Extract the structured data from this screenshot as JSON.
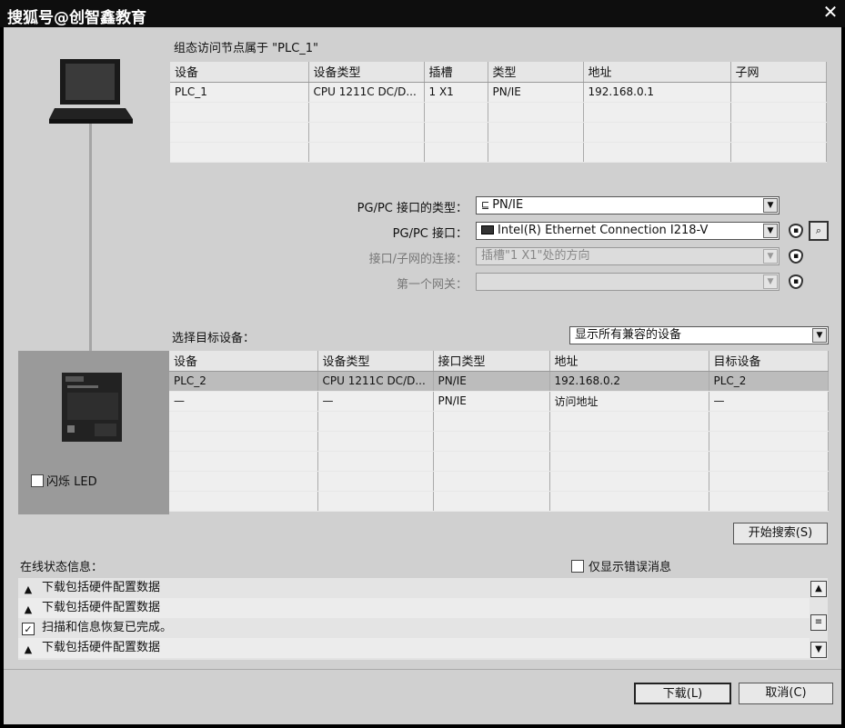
{
  "window": {
    "title": "搜狐号@创智鑫教育",
    "close_glyph": "✕"
  },
  "pg_section": {
    "heading": "组态访问节点属于 \"PLC_1\"",
    "columns": [
      "设备",
      "设备类型",
      "插槽",
      "类型",
      "地址",
      "子网"
    ],
    "rows": [
      [
        "PLC_1",
        "CPU 1211C DC/D...",
        "1 X1",
        "PN/IE",
        "192.168.0.1",
        ""
      ]
    ]
  },
  "settings": {
    "iface_type_label": "PG/PC 接口的类型：",
    "iface_type_value": "PN/IE",
    "iface_label": "PG/PC 接口：",
    "iface_value": "Intel(R) Ethernet Connection I218-V",
    "subnet_conn_label": "接口/子网的连接：",
    "subnet_conn_value": "插槽\"1 X1\"处的方向",
    "gateway_label": "第一个网关：",
    "gateway_value": ""
  },
  "target": {
    "label": "选择目标设备：",
    "filter_value": "显示所有兼容的设备",
    "columns": [
      "设备",
      "设备类型",
      "接口类型",
      "地址",
      "目标设备"
    ],
    "rows": [
      [
        "PLC_2",
        "CPU 1211C DC/D...",
        "PN/IE",
        "192.168.0.2",
        "PLC_2"
      ],
      [
        "—",
        "—",
        "PN/IE",
        "访问地址",
        "—"
      ]
    ],
    "flash_led_label": "闪烁 LED",
    "start_search_label": "开始搜索(S)"
  },
  "status": {
    "heading": "在线状态信息：",
    "errors_only_label": "仅显示错误消息",
    "messages": [
      {
        "icon": "warning",
        "text": "下载包括硬件配置数据"
      },
      {
        "icon": "warning",
        "text": "下载包括硬件配置数据"
      },
      {
        "icon": "success",
        "text": "扫描和信息恢复已完成。"
      },
      {
        "icon": "warning",
        "text": "下载包括硬件配置数据"
      }
    ]
  },
  "footer": {
    "download_label": "下载(L)",
    "cancel_label": "取消(C)"
  }
}
